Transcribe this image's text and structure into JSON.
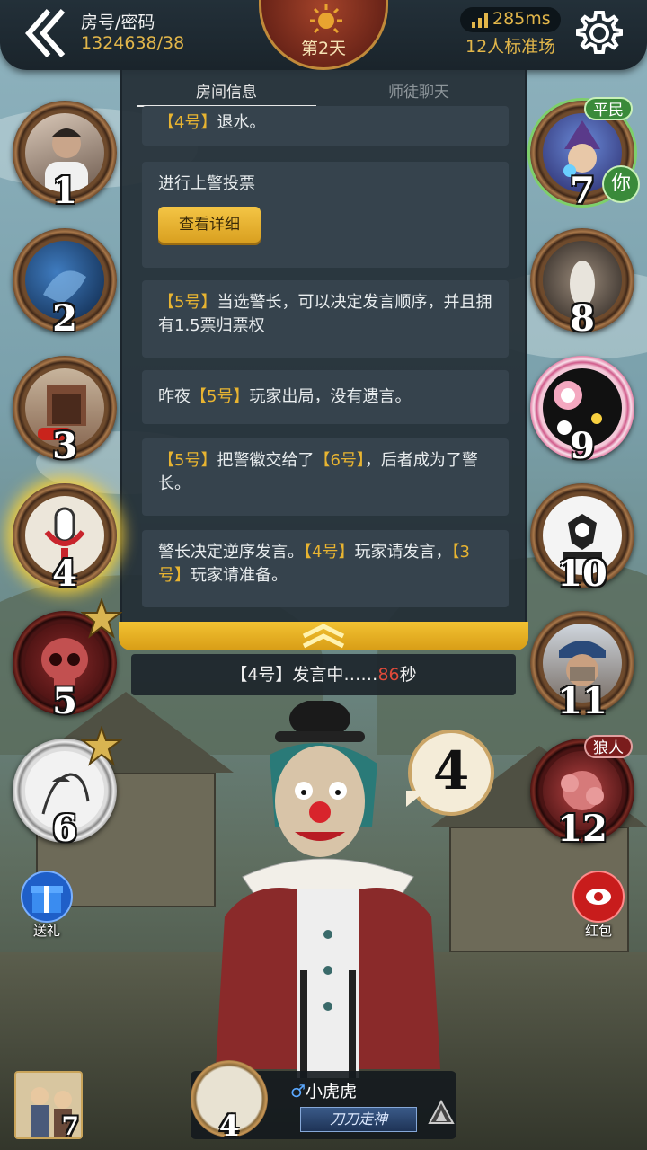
{
  "header": {
    "room_label": "房号/密码",
    "room_value": "1324638/38",
    "day": "第2天",
    "ping": "285ms",
    "mode": "12人标准场"
  },
  "tabs": [
    {
      "label": "房间信息",
      "active": true
    },
    {
      "label": "师徒聊天",
      "active": false
    }
  ],
  "messages": {
    "m0": {
      "p1": "【4号】",
      "p2": "退水。"
    },
    "m1": {
      "text": "进行上警投票",
      "button": "查看详细"
    },
    "m2": {
      "p1": "【5号】",
      "p2": "当选警长，可以决定发言顺序，并且拥有1.5票归票权"
    },
    "m3": {
      "p1": "昨夜",
      "p2": "【5号】",
      "p3": "玩家出局，没有遗言。"
    },
    "m4": {
      "p1": "【5号】",
      "p2": "把警徽交给了",
      "p3": "【6号】",
      "p4": "，后者成为了警长。"
    },
    "m5": {
      "p1": "警长决定逆序发言。",
      "p2": "【4号】",
      "p3": "玩家请发言，",
      "p4": "【3号】",
      "p5": "玩家请准备。"
    }
  },
  "speaking": {
    "prefix": "【4号】发言中……",
    "seconds": "86",
    "suffix": "秒"
  },
  "seats": {
    "s1": {
      "num": "1"
    },
    "s2": {
      "num": "2"
    },
    "s3": {
      "num": "3"
    },
    "s4": {
      "num": "4"
    },
    "s5": {
      "num": "5"
    },
    "s6": {
      "num": "6"
    },
    "s7": {
      "num": "7",
      "role": "平民",
      "you": "你"
    },
    "s8": {
      "num": "8"
    },
    "s9": {
      "num": "9"
    },
    "s10": {
      "num": "10"
    },
    "s11": {
      "num": "11"
    },
    "s12": {
      "num": "12",
      "role": "狼人"
    }
  },
  "speech_bubble": "4",
  "gift_label": "送礼",
  "redpacket_label": "红包",
  "nameplate": {
    "gender": "♂",
    "name": "小虎虎",
    "title": "刀刀走神",
    "num": "4"
  },
  "me_num": "7",
  "colors": {
    "accent": "#e8b431",
    "panel": "#36434d",
    "timer": "#e04a3a"
  }
}
